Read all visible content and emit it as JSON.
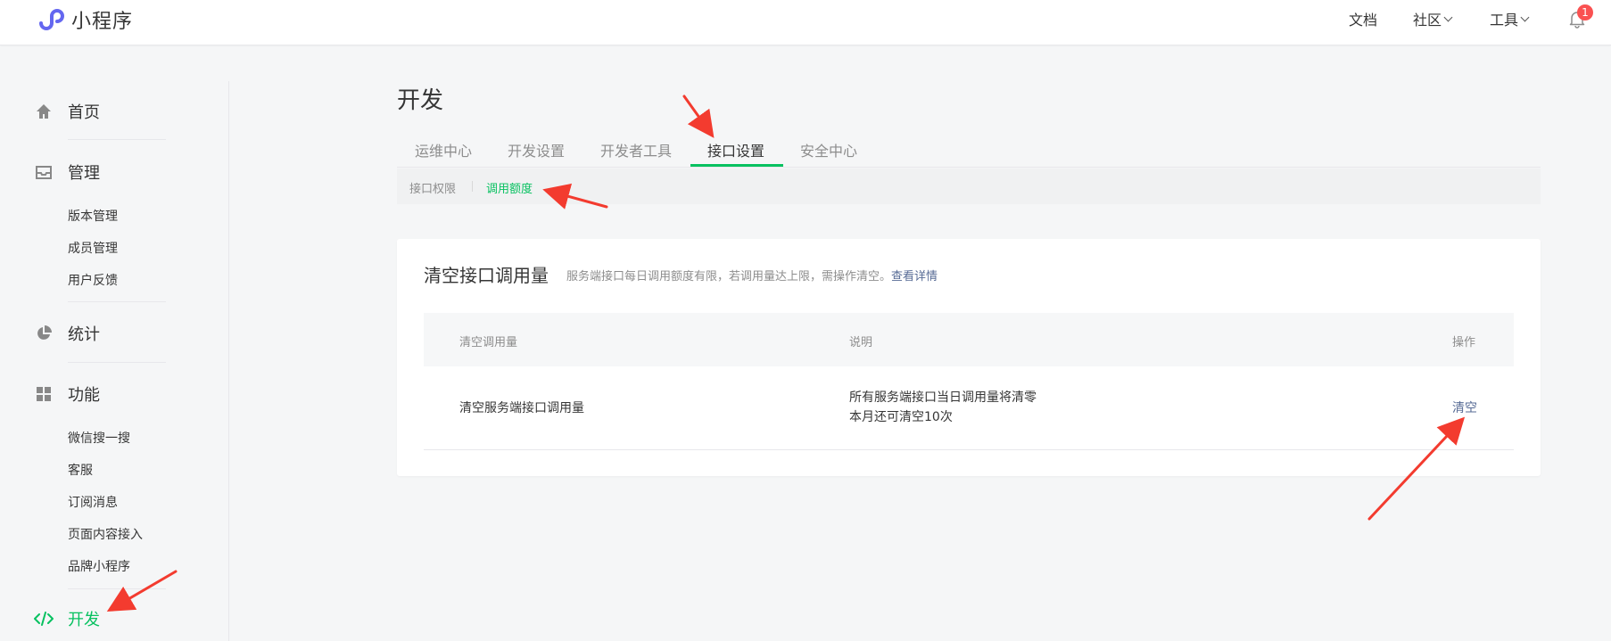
{
  "app": {
    "title": "小程序"
  },
  "topnav": {
    "docs": "文档",
    "community": "社区",
    "tools": "工具",
    "notifications": "1"
  },
  "sidebar": {
    "home": "首页",
    "manage": "管理",
    "manage_items": [
      "版本管理",
      "成员管理",
      "用户反馈"
    ],
    "stats": "统计",
    "features": "功能",
    "feature_items": [
      "微信搜一搜",
      "客服",
      "订阅消息",
      "页面内容接入",
      "品牌小程序"
    ],
    "develop": "开发"
  },
  "main": {
    "title": "开发",
    "tabs": [
      "运维中心",
      "开发设置",
      "开发者工具",
      "接口设置",
      "安全中心"
    ],
    "subtabs": [
      "接口权限",
      "调用额度"
    ],
    "card": {
      "title": "清空接口调用量",
      "desc": "服务端接口每日调用额度有限，若调用量达上限，需操作清空。",
      "desc_link": "查看详情",
      "headers": [
        "清空调用量",
        "说明",
        "操作"
      ],
      "row": {
        "name": "清空服务端接口调用量",
        "note_line1": "所有服务端接口当日调用量将清零",
        "note_line2": "本月还可清空10次",
        "action": "清空"
      }
    }
  },
  "colors": {
    "accent": "#07c160",
    "link": "#576b95",
    "annotation": "#f33b2f",
    "badge": "#fa5151",
    "logo": "#6467f0"
  }
}
